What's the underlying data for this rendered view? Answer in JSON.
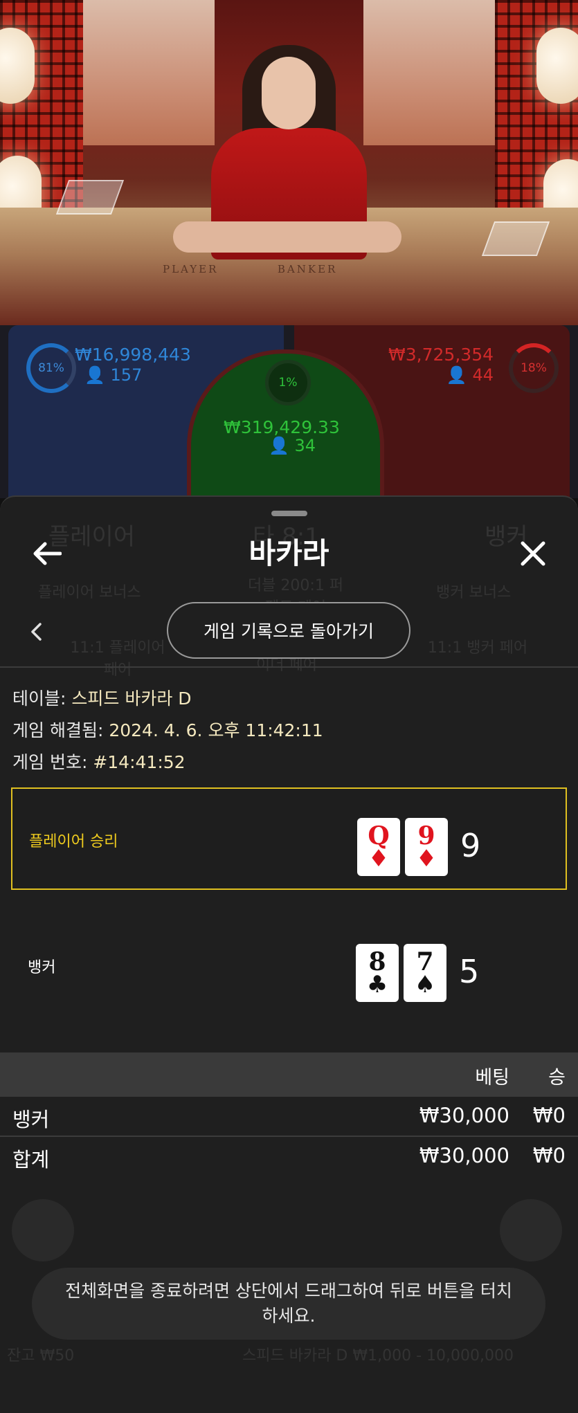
{
  "table_felt": {
    "player_text": "PLAYER",
    "banker_text": "BANKER"
  },
  "bets": {
    "player": {
      "percent": "81%",
      "amount": "₩16,998,443",
      "count": "157"
    },
    "tie": {
      "percent": "1%",
      "amount": "₩319,429.33",
      "count": "34"
    },
    "banker": {
      "percent": "18%",
      "amount": "₩3,725,354",
      "count": "44"
    }
  },
  "sheet": {
    "title": "바카라",
    "history_button": "게임 기록으로 돌아가기",
    "info": {
      "table_label": "테이블:",
      "table_value": "스피드 바카라 D",
      "resolved_label": "게임 해결됨:",
      "resolved_value": "2024. 4. 6. 오후 11:42:11",
      "game_no_label": "게임 번호:",
      "game_no_value": "#14:41:52"
    },
    "hands": {
      "player": {
        "label": "플레이어 승리",
        "cards": [
          {
            "rank": "Q",
            "suit": "♦",
            "color": "#e0141e"
          },
          {
            "rank": "9",
            "suit": "♦",
            "color": "#e0141e"
          }
        ],
        "score": "9"
      },
      "banker": {
        "label": "뱅커",
        "cards": [
          {
            "rank": "8",
            "suit": "♣",
            "color": "#111111"
          },
          {
            "rank": "7",
            "suit": "♠",
            "color": "#111111"
          }
        ],
        "score": "5"
      }
    },
    "bets_table": {
      "headers": {
        "bet": "베팅",
        "win": "승"
      },
      "rows": [
        {
          "name": "뱅커",
          "bet": "₩30,000",
          "win": "₩0"
        },
        {
          "name": "합계",
          "bet": "₩30,000",
          "win": "₩0"
        }
      ]
    },
    "toast": "전체화면을 종료하려면 상단에서 드래그하여 뒤로 버튼을 터치하세요."
  },
  "background_ui": {
    "player": "플레이어",
    "tie_odds": "타 8:1",
    "banker": "뱅커",
    "player_bonus": "플레이어 보너스",
    "perfect_pair": "더블 200:1 퍼펙트 페어",
    "banker_bonus": "뱅커 보너스",
    "player_pair": "11:1 플레이어 페어",
    "either_pair": "이더 페어",
    "banker_pair": "11:1 뱅커 페어",
    "balance": "잔고 ₩50",
    "table_limits": "스피드 바카라 D  ₩1,000 - 10,000,000"
  }
}
